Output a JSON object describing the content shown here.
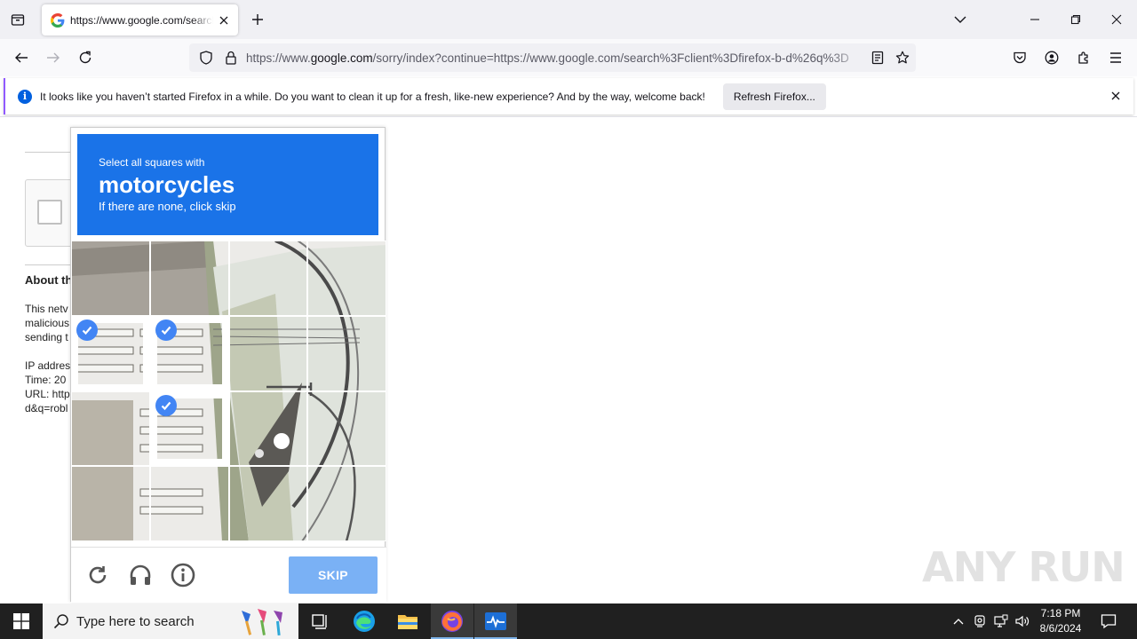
{
  "browser": {
    "tab": {
      "title": "https://www.google.com/search?client=firefox"
    },
    "address": {
      "scheme_prefix": "https://www.",
      "domain": "google.com",
      "path": "/sorry/index?continue=https://www.google.com/search%3Fclient%3Dfirefox-b-d%26q%3D"
    },
    "notification": {
      "message": "It looks like you haven’t started Firefox in a while. Do you want to clean it up for a fresh, like-new experience? And by the way, welcome back!",
      "button": "Refresh Firefox..."
    }
  },
  "page": {
    "about_heading": "About th",
    "body_lines": [
      "This netv",
      "malicious",
      "sending t"
    ],
    "details": [
      "IP addres",
      "Time: 20",
      "URL: http",
      "d&q=robl"
    ]
  },
  "captcha": {
    "instruction": "Select all squares with",
    "target": "motorcycles",
    "hint": "If there are none, click skip",
    "skip_label": "SKIP",
    "grid": {
      "rows": 4,
      "cols": 4
    },
    "selected_tiles": [
      [
        1,
        0
      ],
      [
        1,
        1
      ],
      [
        2,
        1
      ]
    ]
  },
  "watermark": "ANY RUN",
  "taskbar": {
    "search_placeholder": "Type here to search",
    "time": "7:18 PM",
    "date": "8/6/2024"
  },
  "colors": {
    "challenge_header": "#1a73e8",
    "skip_button": "#7ab1f5",
    "check_badge": "#4285f4",
    "notification_accent": "#9059ff"
  }
}
